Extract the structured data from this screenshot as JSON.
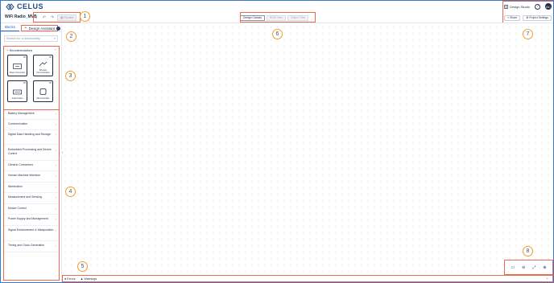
{
  "app": {
    "brand": "CELUS",
    "project_name": "WiFi Radio_MVB"
  },
  "toolbar": {
    "routine_label": "Routine"
  },
  "header_right": {
    "studio_label": "Design Studio",
    "help_icon": "?",
    "avatar_initials": "BC"
  },
  "center_tabs": [
    {
      "label": "Design Canvas",
      "active": true
    },
    {
      "label": "BOM View",
      "active": false
    },
    {
      "label": "Output Files",
      "active": false
    }
  ],
  "right_actions": {
    "share_label": "Share",
    "settings_label": "Project Settings"
  },
  "sidebar": {
    "tabs": [
      {
        "label": "Blocks"
      },
      {
        "label": "Design Assistant"
      }
    ],
    "search_placeholder": "Search for a functionality",
    "recommendations": {
      "title": "Recommendations",
      "cards": [
        {
          "label": "Power Conversion",
          "badge": "3H"
        },
        {
          "label": "Wireless Communication",
          "badge": "3H"
        },
        {
          "label": "Audio Output",
          "badge": "3H"
        },
        {
          "label": "Microcontroller",
          "badge": "3H"
        }
      ]
    },
    "categories": [
      "Battery Management",
      "Communication",
      "Digital Data Handling and Storage",
      "Embedded Processing and Device Control",
      "Generic Connectors",
      "Human Machine Interface",
      "Illumination",
      "Measurement and Sensing",
      "Motion Control",
      "Power Supply and Management",
      "Signal Enhancement & Manipulation",
      "Timing and Clock Generation"
    ]
  },
  "bottom_bar": {
    "errors_label": "Errors",
    "warnings_label": "Warnings"
  },
  "callouts": [
    "1",
    "2",
    "3",
    "4",
    "5",
    "6",
    "7",
    "8"
  ],
  "colors": {
    "accent": "#2a66c4",
    "highlight": "#ec6a4f",
    "callout": "#f39b2f",
    "border": "#3b78c9"
  }
}
